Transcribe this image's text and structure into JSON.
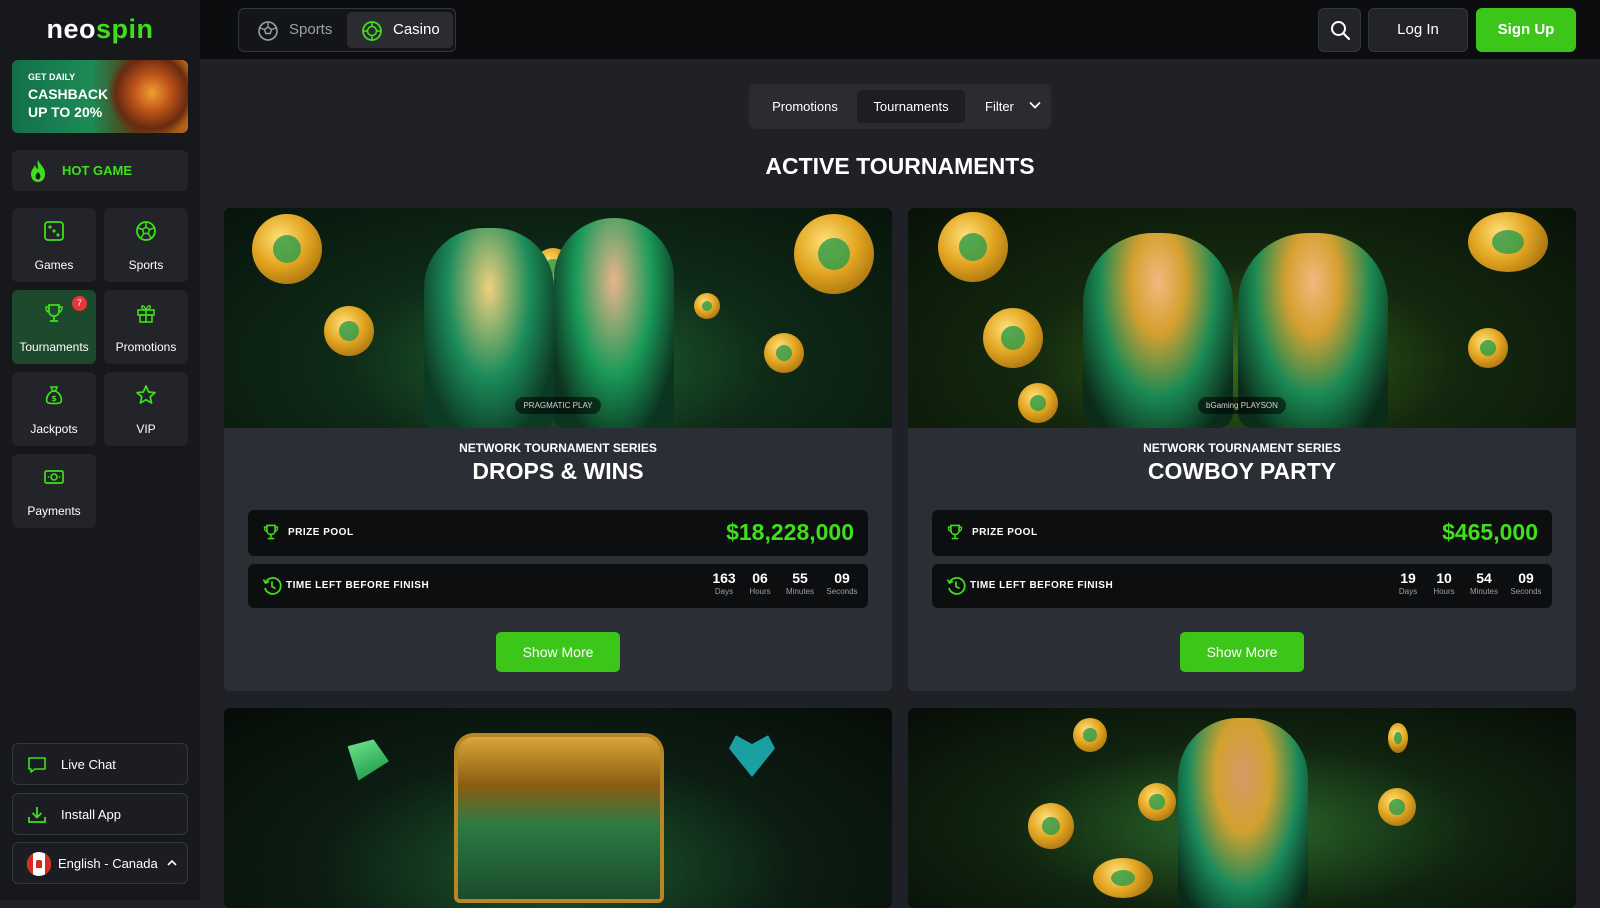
{
  "brand": {
    "logo_left": "neo",
    "logo_right": "spin"
  },
  "sidebar": {
    "cashback": {
      "line1": "GET DAILY",
      "line2": "CASHBACK",
      "line3": "UP TO 20%"
    },
    "hot_game": "HOT GAME",
    "tiles": [
      {
        "label": "Games",
        "icon": "dice-icon"
      },
      {
        "label": "Sports",
        "icon": "soccer-ball-icon"
      },
      {
        "label": "Tournaments",
        "icon": "trophy-icon",
        "badge": "7"
      },
      {
        "label": "Promotions",
        "icon": "gift-icon"
      },
      {
        "label": "Jackpots",
        "icon": "money-bag-icon"
      },
      {
        "label": "VIP",
        "icon": "star-icon"
      },
      {
        "label": "Payments",
        "icon": "cash-icon"
      }
    ],
    "live_chat": "Live Chat",
    "install_app": "Install App",
    "language": "English - Canada"
  },
  "topbar": {
    "sports_label": "Sports",
    "casino_label": "Casino",
    "login_label": "Log In",
    "signup_label": "Sign Up"
  },
  "filters": {
    "promotions": "Promotions",
    "tournaments": "Tournaments",
    "filter": "Filter"
  },
  "heading": "ACTIVE TOURNAMENTS",
  "tournaments": [
    {
      "series": "NETWORK TOURNAMENT SERIES",
      "title": "DROPS & WINS",
      "provider": "PRAGMATIC PLAY",
      "prize_label": "PRIZE POOL",
      "prize": "$18,228,000",
      "time_label": "TIME LEFT BEFORE FINISH",
      "days": "163",
      "hours": "06",
      "minutes": "55",
      "seconds": "09",
      "days_u": "Days",
      "hours_u": "Hours",
      "minutes_u": "Minutes",
      "seconds_u": "Seconds",
      "button": "Show More"
    },
    {
      "series": "NETWORK TOURNAMENT SERIES",
      "title": "COWBOY PARTY",
      "provider": "bGaming  PLAYSON",
      "prize_label": "PRIZE POOL",
      "prize": "$465,000",
      "time_label": "TIME LEFT BEFORE FINISH",
      "days": "19",
      "hours": "10",
      "minutes": "54",
      "seconds": "09",
      "days_u": "Days",
      "hours_u": "Hours",
      "minutes_u": "Minutes",
      "seconds_u": "Seconds",
      "button": "Show More"
    }
  ],
  "colors": {
    "accent": "#3dc61a",
    "accent_text": "#3fe01b",
    "bg": "#1f2127",
    "sidebar": "#16181c",
    "card": "#2b2e35"
  }
}
